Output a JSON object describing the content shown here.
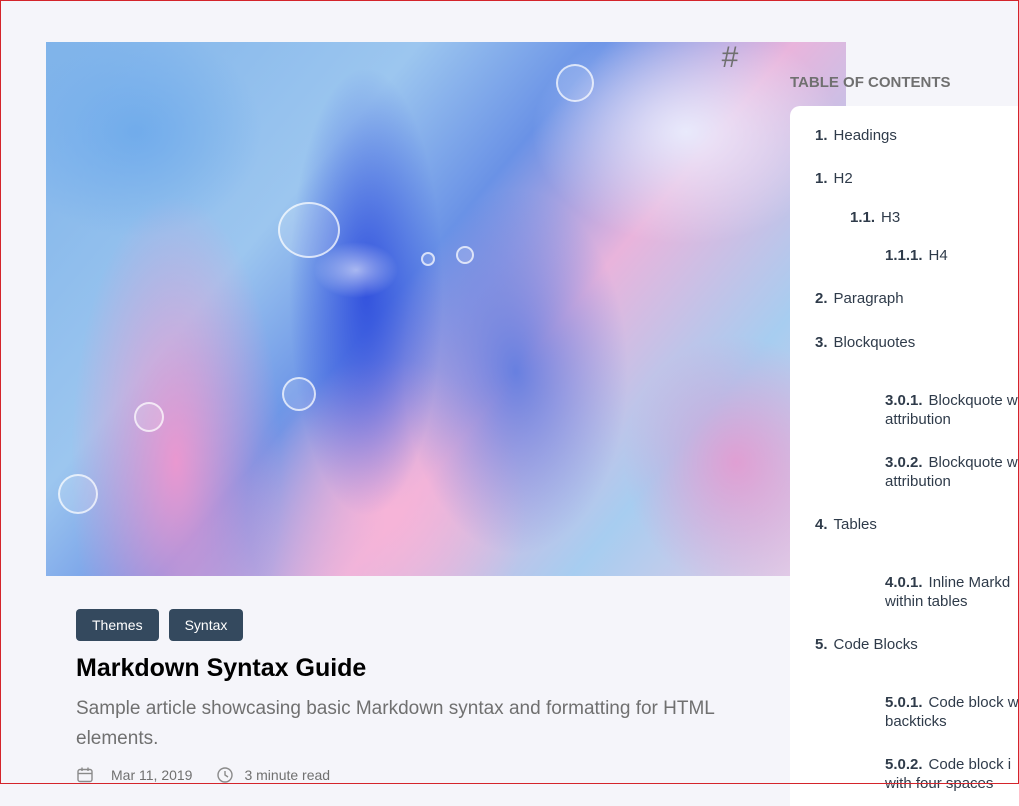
{
  "tags": [
    "Themes",
    "Syntax"
  ],
  "article": {
    "title": "Markdown Syntax Guide",
    "description": "Sample article showcasing basic Markdown syntax and formatting for HTML elements.",
    "date": "Mar 11, 2019",
    "read_time": "3 minute read"
  },
  "toc": {
    "icon": "#",
    "title": "TABLE OF CONTENTS",
    "items": [
      {
        "num": "1.",
        "label": "Headings"
      },
      {
        "num": "1.",
        "label": "H2"
      },
      {
        "num": "1.1.",
        "label": "H3"
      },
      {
        "num": "1.1.1.",
        "label": "H4"
      },
      {
        "num": "2.",
        "label": "Paragraph"
      },
      {
        "num": "3.",
        "label": "Blockquotes"
      },
      {
        "num": "3.0.1.",
        "label": "Blockquote w",
        "label2": "attribution"
      },
      {
        "num": "3.0.2.",
        "label": "Blockquote w",
        "label2": "attribution"
      },
      {
        "num": "4.",
        "label": "Tables"
      },
      {
        "num": "4.0.1.",
        "label": "Inline Markd",
        "label2": "within tables"
      },
      {
        "num": "5.",
        "label": "Code Blocks"
      },
      {
        "num": "5.0.1.",
        "label": "Code block w",
        "label2": "backticks"
      },
      {
        "num": "5.0.2.",
        "label": "Code block i",
        "label2": "with four spaces"
      }
    ]
  },
  "icons": {
    "date": "calendar-icon",
    "read_time": "clock-icon"
  },
  "colors": {
    "tag_bg": "#34495e",
    "background": "#f5f5fa",
    "toc_text": "#2f3b4a"
  }
}
